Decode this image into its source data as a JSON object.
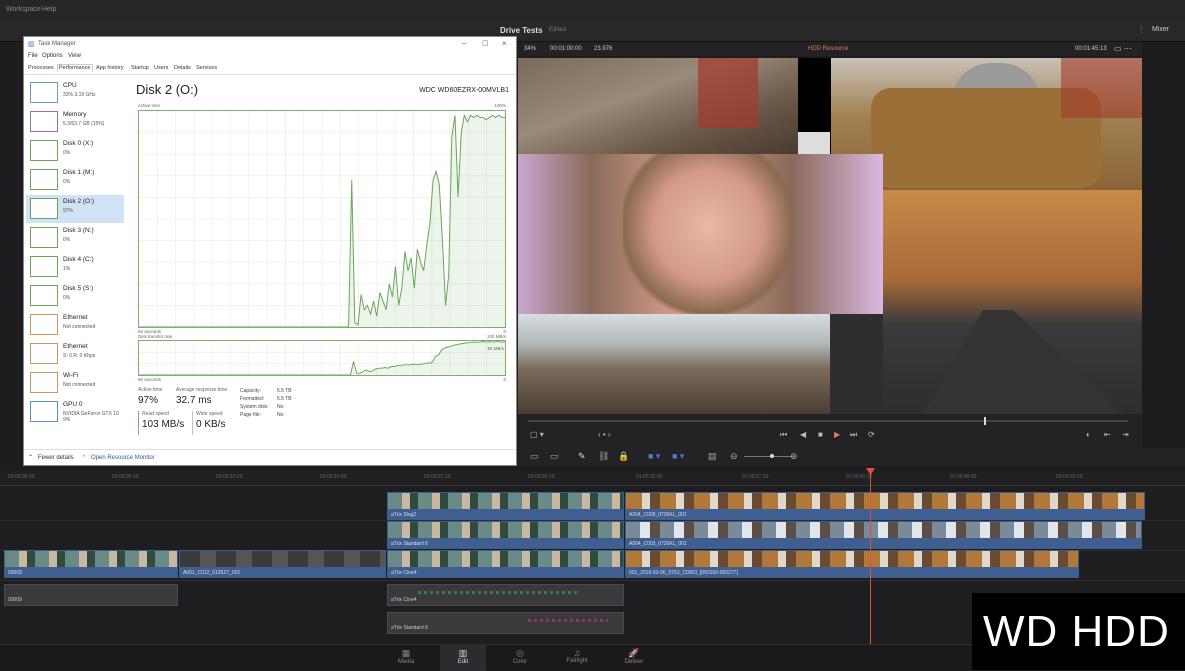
{
  "resolve": {
    "menu": [
      "Workspace",
      "Help"
    ],
    "project_title": "Drive Tests",
    "project_status": "Edited",
    "mixer_label": "Mixer",
    "viewer": {
      "zoom": "34%",
      "source_tc": "00:01:00:00",
      "duration": "23.976",
      "clip_name": "HDD Resource",
      "timecode": "00:01:45:13"
    },
    "ruler_ticks": [
      "01:00:00:00",
      "01:00:05:10",
      "01:00:10:20",
      "01:00:16:00",
      "01:00:21:10",
      "01:00:26:20",
      "01:00:32:00",
      "01:00:37:10",
      "01:00:42:20",
      "01:00:48:00",
      "01:00:53:10"
    ],
    "clips": {
      "v3_a": "aTrix Slog2",
      "v3_b": "A004_C009_0726KL_001",
      "v2_a": "aTrix Standard 8",
      "v2_b": "A004_C003_0726KL_001",
      "v1_a": "00009",
      "v1_b": "A001_C012_0126Z7_001",
      "v1_c": "aTrix Cine4",
      "v1_d": "001_2016-03-06_0762_C0003_[060150-060277]",
      "a1": "00009",
      "a2": "aTrix Cine4",
      "a3": "aTrix Standard 8"
    },
    "pages": [
      "Media",
      "Edit",
      "Color",
      "Fairlight",
      "Deliver"
    ],
    "active_page": "Edit"
  },
  "taskmanager": {
    "title": "Task Manager",
    "menu": [
      "File",
      "Options",
      "View"
    ],
    "tabs": [
      "Processes",
      "Performance",
      "App history",
      "Startup",
      "Users",
      "Details",
      "Services"
    ],
    "active_tab": "Performance",
    "sidebar": [
      {
        "name": "CPU",
        "sub": "33% 3.19 GHz",
        "kind": "cpu"
      },
      {
        "name": "Memory",
        "sub": "5.3/63.7 GB (15%)",
        "kind": "mem"
      },
      {
        "name": "Disk 0 (X:)",
        "sub": "0%",
        "kind": "disk"
      },
      {
        "name": "Disk 1 (M:)",
        "sub": "0%",
        "kind": "disk"
      },
      {
        "name": "Disk 2 (O:)",
        "sub": "97%",
        "kind": "disk"
      },
      {
        "name": "Disk 3 (N:)",
        "sub": "0%",
        "kind": "disk"
      },
      {
        "name": "Disk 4 (C:)",
        "sub": "1%",
        "kind": "disk"
      },
      {
        "name": "Disk 5 (S:)",
        "sub": "0%",
        "kind": "disk"
      },
      {
        "name": "Ethernet",
        "sub": "Not connected",
        "kind": "net"
      },
      {
        "name": "Ethernet",
        "sub": "S: 0 R: 0 Kbps",
        "kind": "net"
      },
      {
        "name": "Wi-Fi",
        "sub": "Not connected",
        "kind": "net"
      },
      {
        "name": "GPU 0",
        "sub": "NVIDIA GeForce GTX 10",
        "sub2": "9%",
        "kind": "gpu"
      }
    ],
    "selected_index": 4,
    "disk_title": "Disk 2 (O:)",
    "disk_model": "WDC WD60EZRX-00MVLB1",
    "graph1": {
      "top_label": "Active time",
      "max_label": "100%",
      "bottom_left": "60 seconds",
      "bottom_right": "0",
      "series": [
        0,
        0,
        0,
        0,
        0,
        0,
        0,
        0,
        0,
        0,
        0,
        0,
        0,
        0,
        0,
        0,
        0,
        0,
        0,
        0,
        0,
        0,
        0,
        0,
        0,
        0,
        0,
        0,
        0,
        0,
        0,
        0,
        0,
        0,
        0,
        0,
        0,
        0,
        0,
        0,
        0,
        0,
        0,
        0,
        0,
        0,
        0,
        0,
        0,
        0,
        0,
        0,
        0,
        0,
        0,
        0,
        0,
        0,
        0,
        0,
        0,
        0,
        0,
        0,
        0,
        0,
        0,
        0,
        68,
        2,
        1,
        15,
        8,
        10,
        6,
        12,
        5,
        16,
        12,
        8,
        20,
        14,
        28,
        10,
        18,
        35,
        26,
        32,
        18,
        36,
        30,
        26,
        38,
        48,
        68,
        72,
        66,
        40,
        10,
        24,
        88,
        98,
        60,
        90,
        98,
        95,
        98,
        97,
        98,
        97,
        97,
        96,
        97,
        98,
        97,
        98,
        97,
        97
      ]
    },
    "graph2": {
      "top_label": "Disk transfer rate",
      "max_label": "100 MB/s",
      "marker": "90 MB/s",
      "bottom_left": "60 seconds",
      "bottom_right": "0",
      "series": [
        0,
        0,
        0,
        0,
        0,
        0,
        0,
        0,
        0,
        0,
        0,
        0,
        0,
        0,
        0,
        0,
        0,
        0,
        0,
        0,
        0,
        0,
        0,
        0,
        0,
        0,
        0,
        0,
        0,
        0,
        0,
        0,
        0,
        0,
        0,
        0,
        0,
        0,
        0,
        0,
        0,
        0,
        0,
        0,
        0,
        0,
        0,
        0,
        0,
        0,
        0,
        0,
        0,
        0,
        0,
        0,
        0,
        0,
        0,
        0,
        0,
        0,
        0,
        0,
        0,
        0,
        0,
        0,
        0.4,
        0.05,
        0.05,
        0.1,
        0.15,
        0.1,
        0.12,
        0.18,
        0.2,
        0.2,
        0.22,
        0.2,
        0.25,
        0.25,
        0.28,
        0.28,
        0.3,
        0.3,
        0.3,
        0.32,
        0.3,
        0.32,
        0.32,
        0.35,
        0.35,
        0.38,
        0.55,
        0.6,
        0.75,
        0.8,
        0.82,
        0.85,
        0.88,
        0.9,
        0.92,
        0.93,
        0.95,
        0.95,
        0.97,
        0.96,
        0.97,
        0.98,
        0.97,
        0.98,
        0.97,
        0.98,
        0.98,
        0.97,
        0.98
      ]
    },
    "stats": {
      "active_time_label": "Active time",
      "active_time": "97%",
      "resp_label": "Average response time",
      "resp": "32.7 ms",
      "read_label": "Read speed",
      "read": "103 MB/s",
      "write_label": "Write speed",
      "write": "0 KB/s"
    },
    "props": [
      {
        "k": "Capacity:",
        "v": "5.5 TB"
      },
      {
        "k": "Formatted:",
        "v": "5.5 TB"
      },
      {
        "k": "System disk:",
        "v": "No"
      },
      {
        "k": "Page file:",
        "v": "No"
      }
    ],
    "footer_fewer": "Fewer details",
    "footer_monitor": "Open Resource Monitor"
  },
  "overlay_caption": "WD HDD",
  "colors": {
    "accent": "#3e5f8f",
    "playhead": "#e64b3c",
    "graph_green": "#6aa55a",
    "select": "#cfe3f5"
  }
}
